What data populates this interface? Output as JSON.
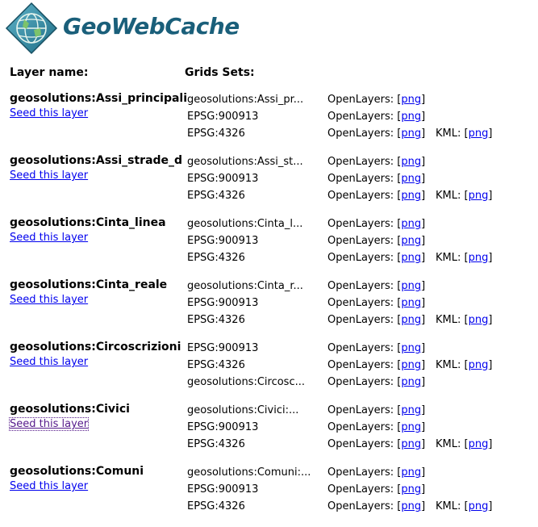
{
  "app": {
    "logo_text": "GeoWebCache"
  },
  "headers": {
    "layer": "Layer name:",
    "grid": "Grids Sets:"
  },
  "seed_label": "Seed this layer",
  "openlayers_label": "OpenLayers:",
  "kml_label": "KML:",
  "png_label": "png",
  "layers": [
    {
      "name": "geosolutions:Assi_principali",
      "grids": [
        {
          "name": "geosolutions:Assi_pr...",
          "openlayers": true,
          "kml": false
        },
        {
          "name": "EPSG:900913",
          "openlayers": true,
          "kml": false
        },
        {
          "name": "EPSG:4326",
          "openlayers": true,
          "kml": true
        }
      ]
    },
    {
      "name": "geosolutions:Assi_strade_d",
      "grids": [
        {
          "name": "geosolutions:Assi_st...",
          "openlayers": true,
          "kml": false
        },
        {
          "name": "EPSG:900913",
          "openlayers": true,
          "kml": false
        },
        {
          "name": "EPSG:4326",
          "openlayers": true,
          "kml": true
        }
      ]
    },
    {
      "name": "geosolutions:Cinta_linea",
      "grids": [
        {
          "name": "geosolutions:Cinta_l...",
          "openlayers": true,
          "kml": false
        },
        {
          "name": "EPSG:900913",
          "openlayers": true,
          "kml": false
        },
        {
          "name": "EPSG:4326",
          "openlayers": true,
          "kml": true
        }
      ]
    },
    {
      "name": "geosolutions:Cinta_reale",
      "grids": [
        {
          "name": "geosolutions:Cinta_r...",
          "openlayers": true,
          "kml": false
        },
        {
          "name": "EPSG:900913",
          "openlayers": true,
          "kml": false
        },
        {
          "name": "EPSG:4326",
          "openlayers": true,
          "kml": true
        }
      ]
    },
    {
      "name": "geosolutions:Circoscrizioni",
      "grids": [
        {
          "name": "EPSG:900913",
          "openlayers": true,
          "kml": false
        },
        {
          "name": "EPSG:4326",
          "openlayers": true,
          "kml": true
        },
        {
          "name": "geosolutions:Circosc...",
          "openlayers": true,
          "kml": false
        }
      ]
    },
    {
      "name": "geosolutions:Civici",
      "seed_visited": true,
      "grids": [
        {
          "name": "geosolutions:Civici:...",
          "openlayers": true,
          "kml": false
        },
        {
          "name": "EPSG:900913",
          "openlayers": true,
          "kml": false
        },
        {
          "name": "EPSG:4326",
          "openlayers": true,
          "kml": true
        }
      ]
    },
    {
      "name": "geosolutions:Comuni",
      "grids": [
        {
          "name": "geosolutions:Comuni:...",
          "openlayers": true,
          "kml": false
        },
        {
          "name": "EPSG:900913",
          "openlayers": true,
          "kml": false
        },
        {
          "name": "EPSG:4326",
          "openlayers": true,
          "kml": true
        }
      ]
    }
  ]
}
